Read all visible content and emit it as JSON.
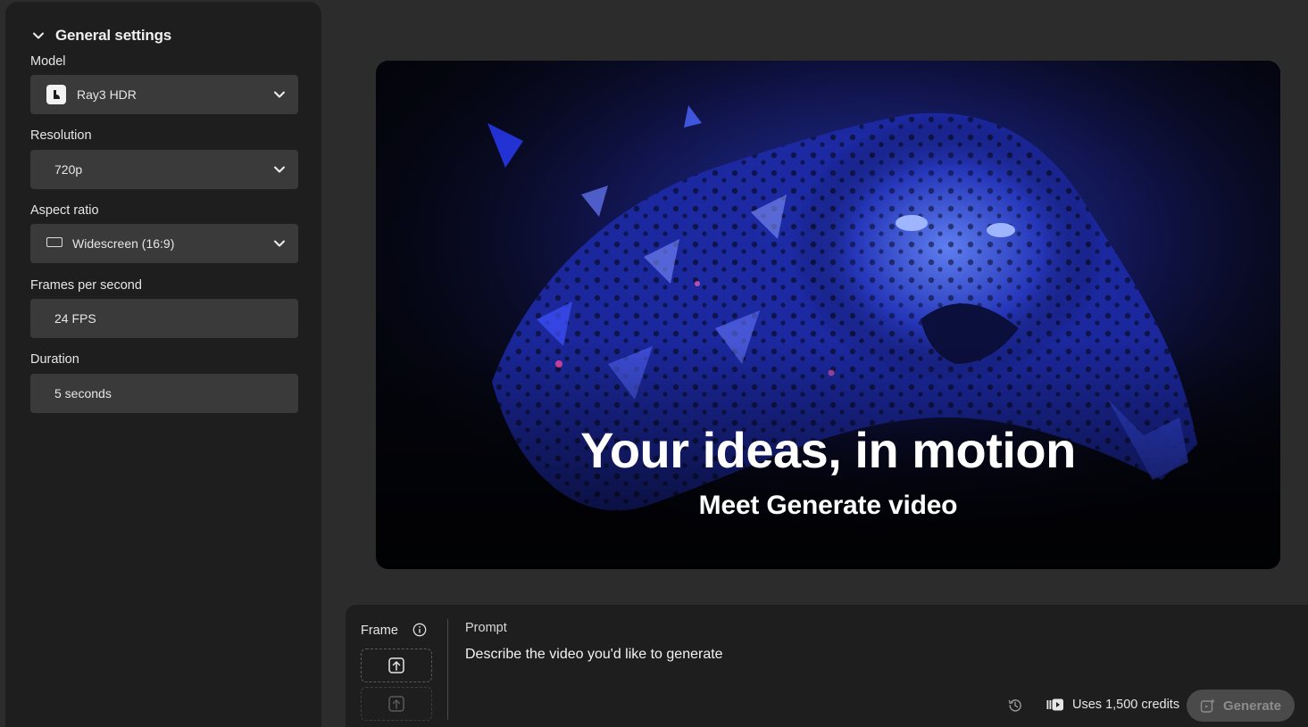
{
  "sidebar": {
    "section_title": "General settings",
    "model": {
      "label": "Model",
      "value": "Ray3 HDR"
    },
    "resolution": {
      "label": "Resolution",
      "value": "720p"
    },
    "aspect_ratio": {
      "label": "Aspect ratio",
      "value": "Widescreen (16:9)"
    },
    "fps": {
      "label": "Frames per second",
      "value": "24 FPS"
    },
    "duration": {
      "label": "Duration",
      "value": "5 seconds"
    }
  },
  "hero": {
    "title": "Your ideas, in motion",
    "subtitle": "Meet Generate video"
  },
  "prompt_panel": {
    "frame_label": "Frame",
    "prompt_label": "Prompt",
    "prompt_placeholder": "Describe the video you'd like to generate",
    "credits_text": "Uses 1,500 credits",
    "generate_label": "Generate"
  },
  "colors": {
    "background": "#2c2c2c",
    "panel": "#1e1e1e",
    "field": "#3a3a3a",
    "hero_accent": "#2a3cff"
  }
}
